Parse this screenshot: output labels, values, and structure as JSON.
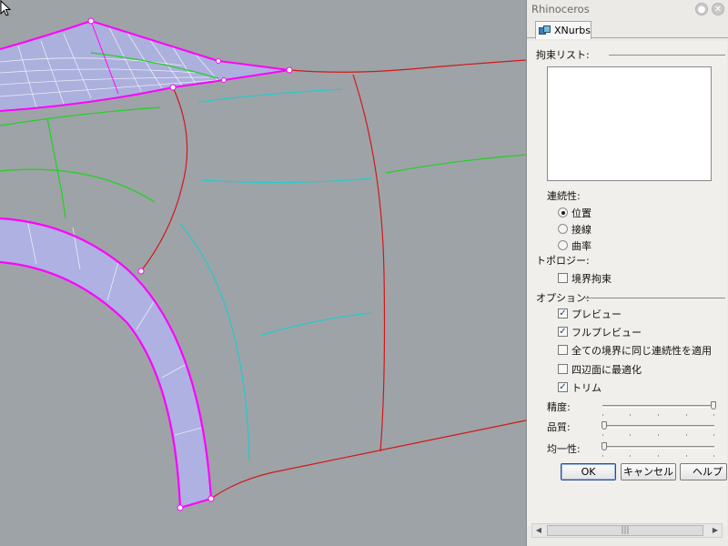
{
  "panel": {
    "title": "Rhinoceros",
    "tab_label": "XNurbs",
    "constraint_list_label": "拘束リスト:",
    "continuity_label": "連続性:",
    "continuity_options": [
      "位置",
      "接線",
      "曲率"
    ],
    "continuity_selected": "位置",
    "topology_label": "トポロジー:",
    "boundary_constraint_label": "境界拘束",
    "boundary_constraint_checked": false,
    "options_label": "オプション:",
    "options": [
      {
        "label": "プレビュー",
        "checked": true
      },
      {
        "label": "フルプレビュー",
        "checked": true
      },
      {
        "label": "全ての境界に同じ連続性を適用",
        "checked": false
      },
      {
        "label": "四辺面に最適化",
        "checked": false
      },
      {
        "label": "トリム",
        "checked": true
      }
    ],
    "sliders": [
      {
        "label": "精度:",
        "level": 1.0
      },
      {
        "label": "品質:",
        "level": 0.0
      },
      {
        "label": "均一性:",
        "level": 0.0
      }
    ],
    "buttons": {
      "ok": "OK",
      "cancel": "キャンセル",
      "help": "ヘルプ"
    },
    "scrollbar_grip": "|||"
  },
  "colors": {
    "viewport_bg": "#9ea3a8",
    "surface_fill": "#aeb1e2",
    "highlight_edge": "#ff00ff",
    "curve_red": "#d21818",
    "curve_green": "#1fd21f",
    "curve_cyan": "#27c8c8"
  },
  "icons": [
    "xnurbs-tab-icon",
    "close-icon",
    "pin-icon",
    "mouse-cursor-icon"
  ]
}
